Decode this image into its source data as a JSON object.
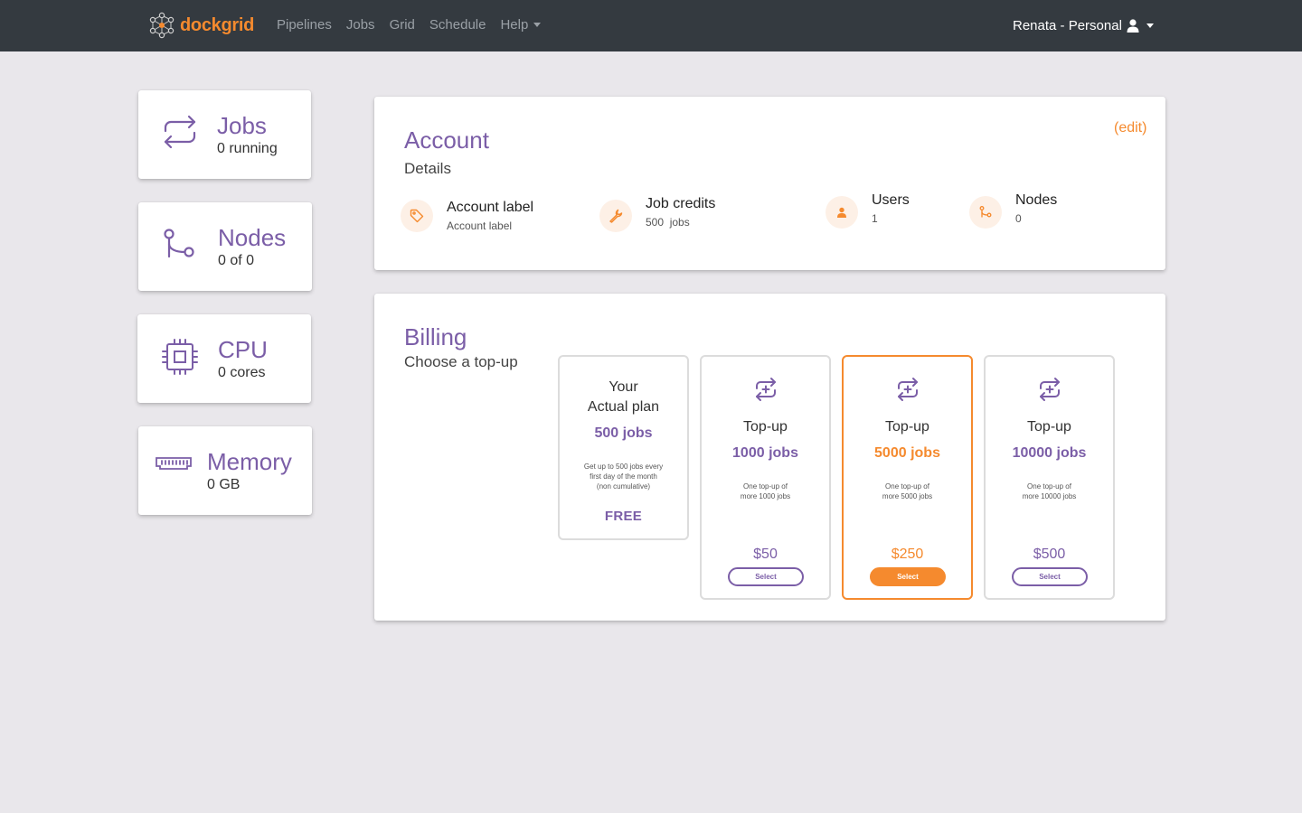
{
  "brand": {
    "name": "dockgrid"
  },
  "nav": {
    "pipelines": "Pipelines",
    "jobs": "Jobs",
    "grid": "Grid",
    "schedule": "Schedule",
    "help": "Help"
  },
  "user": {
    "label": "Renata - Personal"
  },
  "sidebar": {
    "jobs": {
      "title": "Jobs",
      "sub": "0 running"
    },
    "nodes": {
      "title": "Nodes",
      "sub": "0 of 0"
    },
    "cpu": {
      "title": "CPU",
      "sub": "0 cores"
    },
    "memory": {
      "title": "Memory",
      "sub": "0 GB"
    }
  },
  "account": {
    "title": "Account",
    "subtitle": "Details",
    "edit": "(edit)",
    "details": [
      {
        "label": "Account label",
        "value": "Account label",
        "icon": "tag-icon"
      },
      {
        "label": "Job credits",
        "value": "500  jobs",
        "icon": "wrench-icon"
      },
      {
        "label": "Users",
        "value": "1",
        "icon": "user-icon"
      },
      {
        "label": "Nodes",
        "value": "0",
        "icon": "node-branch-icon"
      }
    ]
  },
  "billing": {
    "title": "Billing",
    "subtitle": "Choose a top-up",
    "current_plan": {
      "title_line1": "Your",
      "title_line2": "Actual plan",
      "jobs": "500 jobs",
      "desc_line1": "Get up to 500 jobs every",
      "desc_line2": "first day of the month",
      "desc_line3": "(non cumulative)",
      "price": "FREE"
    },
    "topups": [
      {
        "title": "Top-up",
        "jobs": "1000 jobs",
        "desc_line1": "One top-up of",
        "desc_line2": "more 1000 jobs",
        "price": "$50",
        "button": "Select"
      },
      {
        "title": "Top-up",
        "jobs": "5000 jobs",
        "desc_line1": "One top-up of",
        "desc_line2": "more 5000 jobs",
        "price": "$250",
        "button": "Select"
      },
      {
        "title": "Top-up",
        "jobs": "10000 jobs",
        "desc_line1": "One top-up of",
        "desc_line2": "more 10000 jobs",
        "price": "$500",
        "button": "Select"
      }
    ]
  },
  "colors": {
    "accent_orange": "#f58a2e",
    "accent_purple": "#7b5ea7",
    "navbar": "#343a40",
    "background": "#e9e7eb"
  }
}
